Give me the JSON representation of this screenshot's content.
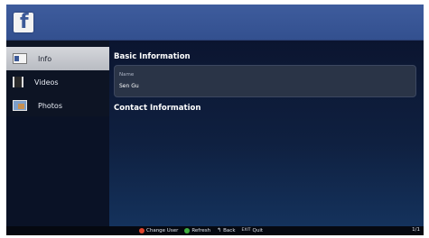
{
  "colors": {
    "accent": "#3b5998",
    "topbar": "#3e5c9d",
    "red_button": "#e0442c",
    "green_button": "#3fae3f"
  },
  "header": {
    "logo_text": "f"
  },
  "sidebar": {
    "items": [
      {
        "label": "Info",
        "icon": "info-card-icon",
        "active": true
      },
      {
        "label": "Videos",
        "icon": "film-icon",
        "active": false
      },
      {
        "label": "Photos",
        "icon": "photo-icon",
        "active": false
      }
    ]
  },
  "main": {
    "basic_title": "Basic Information",
    "name_label": "Name",
    "name_value": "Sen Gu",
    "contact_title": "Contact Information"
  },
  "footer": {
    "change_user": "Change User",
    "refresh": "Refresh",
    "back": "Back",
    "exit_key": "EXIT",
    "quit": "Quit",
    "page": "1/1"
  }
}
